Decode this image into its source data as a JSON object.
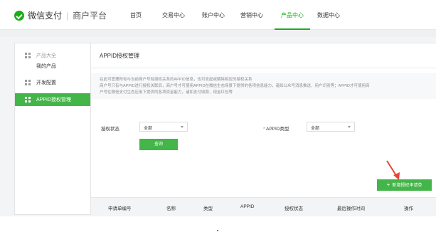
{
  "header": {
    "brand": "微信支付",
    "separator": "|",
    "sub_brand": "商户平台",
    "nav": [
      {
        "label": "首页"
      },
      {
        "label": "交易中心"
      },
      {
        "label": "账户中心"
      },
      {
        "label": "营销中心"
      },
      {
        "label": "产品中心",
        "active": true
      },
      {
        "label": "数据中心"
      }
    ]
  },
  "sidebar": {
    "group_title": "产品大全",
    "group_item": "我的产品",
    "items": [
      {
        "label": "开发配置"
      },
      {
        "label": "APPID授权管理",
        "active": true
      }
    ]
  },
  "main": {
    "title": "APPID授权管理",
    "description": [
      "在此可管理所有与当前商户号有授权关系的APPID信息，也可发起或解除相应的授权关系",
      "商户号只有与APPID进行授权关联后，商户号才可使用APPID在微信生态场景下提供的各项信息能力，诸如公众号消息推送、用户识别等；APPID才可使用商",
      "户号在微信支付生态应用下提供的各项资金能力，诸如支付收款、现金红包等"
    ],
    "filters": {
      "status_label": "授权状态",
      "status_value": "全部",
      "type_required_mark": "*",
      "type_label": "APPID类型",
      "type_value": "全部"
    },
    "query_button": "查询",
    "add_button": "新增授权申请单",
    "add_button_icon": "plus-icon",
    "table_headers": [
      "申请单编号",
      "名称",
      "类型",
      "APPID",
      "授权状态",
      "最后操作时间",
      "操作"
    ]
  },
  "colors": {
    "brand_green": "#1aad19",
    "button_green": "#44b549",
    "arrow_red": "#e8463a"
  }
}
